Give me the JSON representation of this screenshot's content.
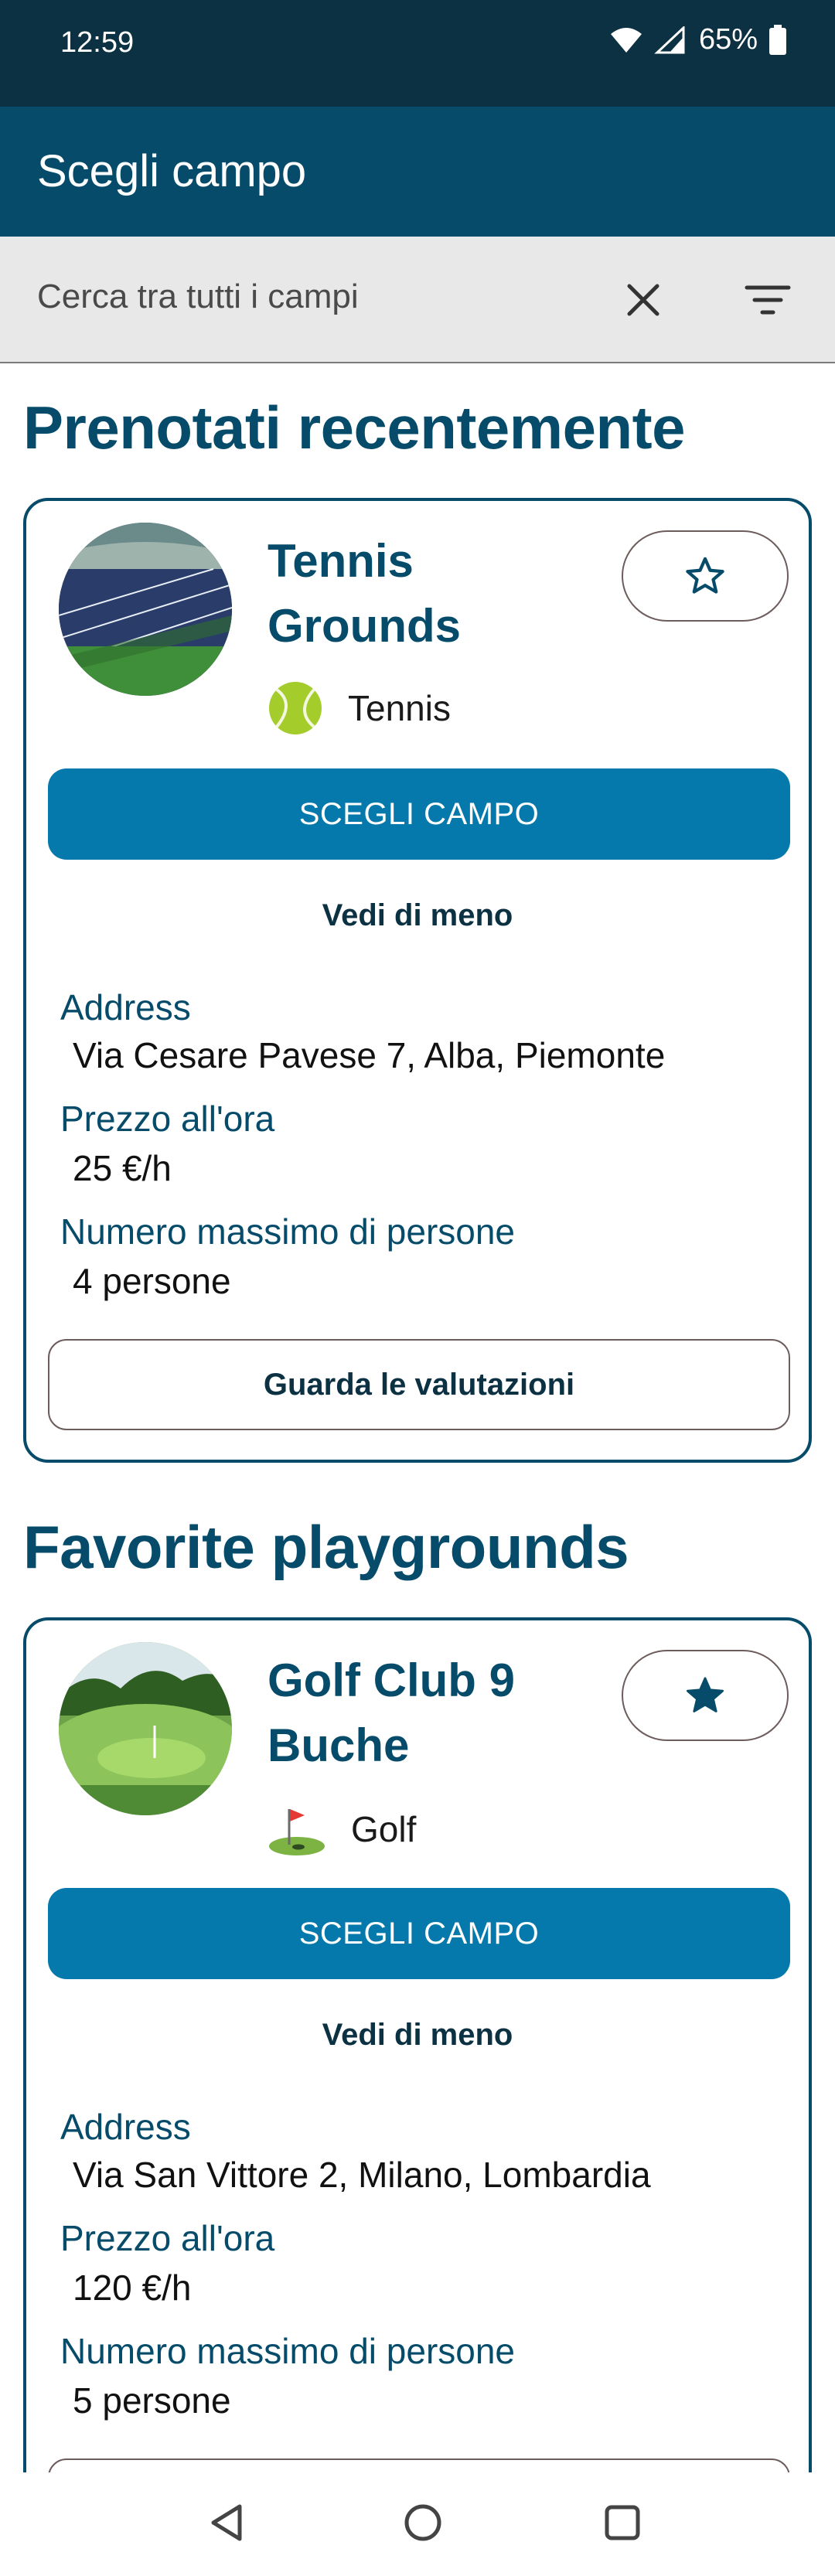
{
  "status": {
    "time": "12:59",
    "battery": "65%"
  },
  "app_bar": {
    "title": "Scegli campo"
  },
  "search": {
    "placeholder": "Cerca tra tutti i campi"
  },
  "sections": {
    "recent_title": "Prenotati recentemente",
    "favorites_title": "Favorite playgrounds"
  },
  "recent_card": {
    "title_line1": "Tennis",
    "title_line2": "Grounds",
    "sport": "Tennis",
    "sport_icon": "tennis-ball-icon",
    "favorite": false,
    "choose_label": "SCEGLI CAMPO",
    "toggle_label": "Vedi di meno",
    "address_label": "Address",
    "address": "Via Cesare Pavese 7, Alba, Piemonte",
    "price_label": "Prezzo all'ora",
    "price": "25 €/h",
    "max_label": "Numero massimo di persone",
    "max": "4 persone",
    "reviews_label": "Guarda le valutazioni"
  },
  "favorite_card": {
    "title_line1": "Golf Club 9",
    "title_line2": "Buche",
    "sport": "Golf",
    "sport_icon": "golf-flag-icon",
    "favorite": true,
    "choose_label": "SCEGLI CAMPO",
    "toggle_label": "Vedi di meno",
    "address_label": "Address",
    "address": "Via San Vittore 2, Milano, Lombardia",
    "price_label": "Prezzo all'ora",
    "price": "120 €/h",
    "max_label": "Numero massimo di persone",
    "max": "5 persone"
  },
  "colors": {
    "primary_dark": "#064b6a",
    "status_bar": "#0b3142",
    "button_blue": "#0579ac"
  }
}
